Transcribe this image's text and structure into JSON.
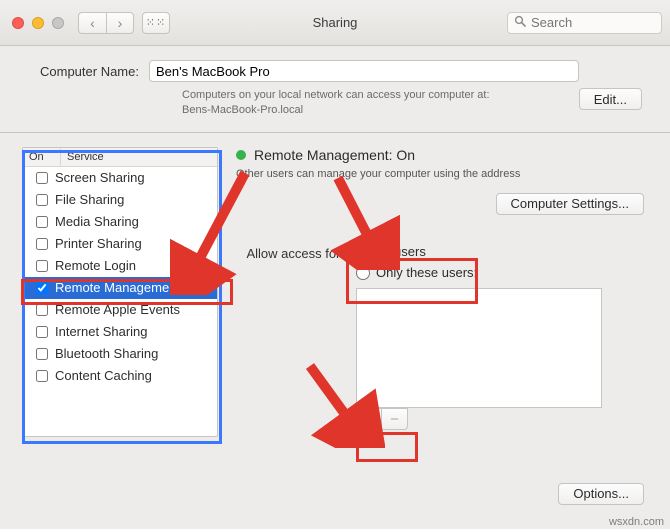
{
  "window": {
    "title": "Sharing",
    "search_placeholder": "Search"
  },
  "computer_name": {
    "label": "Computer Name:",
    "value": "Ben's MacBook Pro",
    "help1": "Computers on your local network can access your computer at:",
    "help2": "Bens-MacBook-Pro.local",
    "edit_label": "Edit..."
  },
  "services": {
    "col_on": "On",
    "col_service": "Service",
    "items": [
      {
        "on": false,
        "label": "Screen Sharing"
      },
      {
        "on": false,
        "label": "File Sharing"
      },
      {
        "on": false,
        "label": "Media Sharing"
      },
      {
        "on": false,
        "label": "Printer Sharing"
      },
      {
        "on": false,
        "label": "Remote Login"
      },
      {
        "on": true,
        "label": "Remote Management"
      },
      {
        "on": false,
        "label": "Remote Apple Events"
      },
      {
        "on": false,
        "label": "Internet Sharing"
      },
      {
        "on": false,
        "label": "Bluetooth Sharing"
      },
      {
        "on": false,
        "label": "Content Caching"
      }
    ]
  },
  "detail": {
    "status_title": "Remote Management: On",
    "status_sub": "Other users can manage your computer using the address",
    "computer_settings_label": "Computer Settings...",
    "allow_label": "Allow access for:",
    "radio_all": "All users",
    "radio_only": "Only these users:",
    "add_label": "+",
    "remove_label": "−",
    "options_label": "Options..."
  },
  "watermark": "wsxdn.com"
}
